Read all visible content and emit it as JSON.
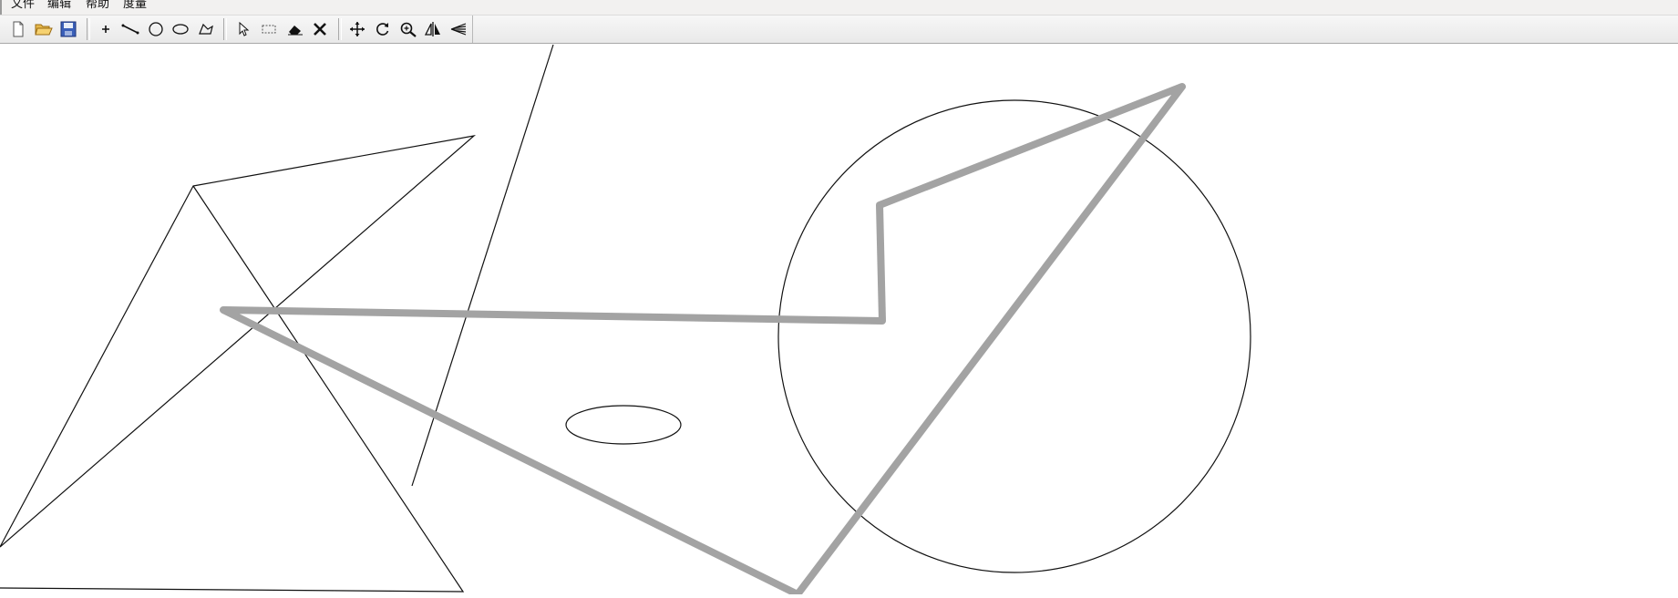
{
  "menubar": {
    "items": [
      {
        "label": "文件"
      },
      {
        "label": "编辑"
      },
      {
        "label": "帮助"
      },
      {
        "label": "度量"
      }
    ]
  },
  "toolbar": {
    "groups": [
      [
        "new-file-icon",
        "open-folder-icon",
        "save-icon"
      ],
      [
        "point-tool-icon",
        "line-tool-icon",
        "circle-tool-icon",
        "ellipse-tool-icon",
        "polygon-tool-icon"
      ],
      [
        "select-arrow-icon",
        "rectangle-select-icon",
        "erase-tool-icon",
        "delete-x-icon"
      ],
      [
        "move-icon",
        "rotate-icon",
        "zoom-icon",
        "mirror-icon",
        "scale-icon"
      ]
    ]
  },
  "colors": {
    "thin_stroke": "#111111",
    "thick_stroke": "#a3a3a3",
    "toolbar_bg": "#eeeeee"
  }
}
